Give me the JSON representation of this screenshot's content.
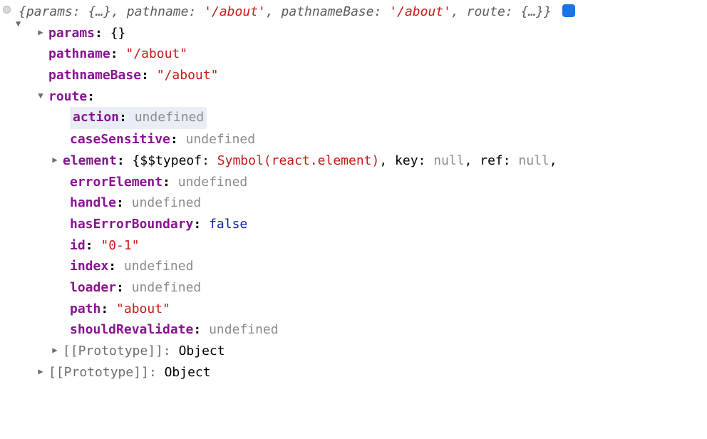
{
  "summary": {
    "params": "params",
    "params_val": "{…}",
    "pathname_k": "pathname",
    "pathname_v": "'/about'",
    "pathnameBase_k": "pathnameBase",
    "pathnameBase_v": "'/about'",
    "route_k": "route",
    "route_v": "{…}",
    "close": "}"
  },
  "obj": {
    "params_k": "params",
    "params_v": "{}",
    "pathname_k": "pathname",
    "pathname_v": "\"/about\"",
    "pathnameBase_k": "pathnameBase",
    "pathnameBase_v": "\"/about\"",
    "route_k": "route"
  },
  "route": {
    "action_k": "action",
    "action_v": "undefined",
    "caseSensitive_k": "caseSensitive",
    "caseSensitive_v": "undefined",
    "element_k": "element",
    "element_summary_pre": "{$$typeof: ",
    "element_sym": "Symbol(react.element)",
    "element_summary_mid1": ", key: ",
    "element_null1": "null",
    "element_summary_mid2": ", ref: ",
    "element_null2": "null",
    "element_summary_end": ",",
    "errorElement_k": "errorElement",
    "errorElement_v": "undefined",
    "handle_k": "handle",
    "handle_v": "undefined",
    "hasErrorBoundary_k": "hasErrorBoundary",
    "hasErrorBoundary_v": "false",
    "id_k": "id",
    "id_v": "\"0-1\"",
    "index_k": "index",
    "index_v": "undefined",
    "loader_k": "loader",
    "loader_v": "undefined",
    "path_k": "path",
    "path_v": "\"about\"",
    "shouldRevalidate_k": "shouldRevalidate",
    "shouldRevalidate_v": "undefined"
  },
  "proto": {
    "label": "[[Prototype]]",
    "value": "Object"
  },
  "info": "i"
}
